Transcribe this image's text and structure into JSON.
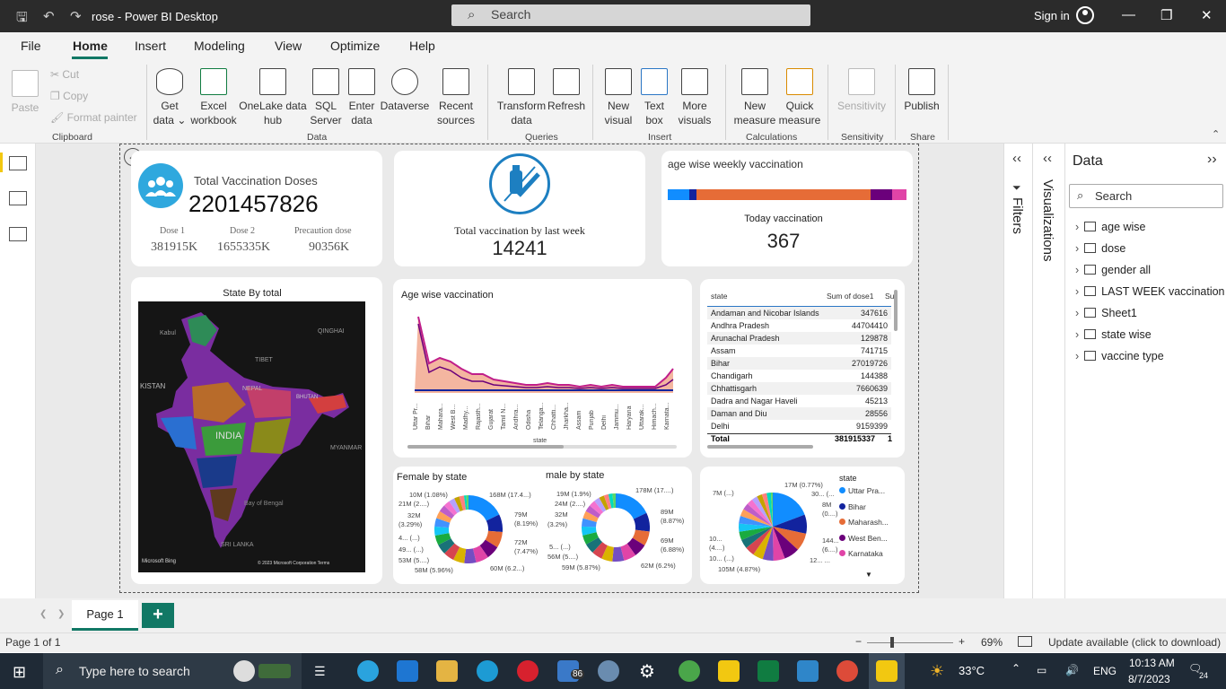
{
  "window": {
    "title": "rose - Power BI Desktop",
    "search_placeholder": "Search",
    "sign_in": "Sign in"
  },
  "menu": [
    "File",
    "Home",
    "Insert",
    "Modeling",
    "View",
    "Optimize",
    "Help"
  ],
  "ribbon": {
    "clipboard": {
      "paste": "Paste",
      "cut": "Cut",
      "copy": "Copy",
      "format_painter": "Format painter",
      "group": "Clipboard"
    },
    "data": {
      "get_data": "Get data",
      "excel": "Excel workbook",
      "onelake": "OneLake data hub",
      "sql": "SQL Server",
      "enter": "Enter data",
      "dataverse": "Dataverse",
      "recent": "Recent sources",
      "group": "Data"
    },
    "queries": {
      "transform": "Transform data",
      "refresh": "Refresh",
      "group": "Queries"
    },
    "insert": {
      "new_visual": "New visual",
      "text_box": "Text box",
      "more": "More visuals",
      "group": "Insert"
    },
    "calculations": {
      "new_measure": "New measure",
      "quick_measure": "Quick measure",
      "group": "Calculations"
    },
    "sensitivity": {
      "label": "Sensitivity",
      "group": "Sensitivity"
    },
    "share": {
      "publish": "Publish",
      "group": "Share"
    }
  },
  "cards": {
    "total": {
      "title": "Total Vaccination Doses",
      "value": "2201457826",
      "dose1_label": "Dose 1",
      "dose1": "381915K",
      "dose2_label": "Dose 2",
      "dose2": "1655335K",
      "prec_label": "Precaution dose",
      "prec": "90356K"
    },
    "lastweek": {
      "label": "Total vaccination by last week",
      "value": "14241"
    },
    "agewise": {
      "title": "age wise weekly vaccination",
      "today_label": "Today vaccination",
      "today": "367"
    }
  },
  "map": {
    "title": "State By total",
    "labels": [
      "INDIA",
      "NEPAL",
      "TIBET",
      "QINGHAI",
      "KISTAN",
      "MYANMAR",
      "SRI LANKA",
      "Kabul",
      "Bay of Bengal",
      "BHUTAN"
    ],
    "attribution": "© 2023 Microsoft Corporation  Terms",
    "logo": "Microsoft Bing"
  },
  "area": {
    "title": "Age wise vaccination",
    "xlabel": "state",
    "states": [
      "Uttar Pr...",
      "Bihar",
      "Mahara...",
      "West B...",
      "Madhy...",
      "Rajasth...",
      "Gujarat",
      "Tamil N...",
      "Andhra...",
      "Odisha",
      "Telanga...",
      "Chhatti...",
      "Jharkha...",
      "Assam",
      "Punjab",
      "Delhi",
      "Jammu...",
      "Haryana",
      "Uttarak...",
      "Himach...",
      "Karnata..."
    ]
  },
  "table": {
    "col1": "state",
    "col2": "Sum of dose1",
    "col3": "Su",
    "rows": [
      [
        "Andaman and Nicobar Islands",
        "347616"
      ],
      [
        "Andhra Pradesh",
        "44704410"
      ],
      [
        "Arunachal Pradesh",
        "129878"
      ],
      [
        "Assam",
        "741715"
      ],
      [
        "Bihar",
        "27019726"
      ],
      [
        "Chandigarh",
        "144388"
      ],
      [
        "Chhattisgarh",
        "7660639"
      ],
      [
        "Dadra and Nagar Haveli",
        "45213"
      ],
      [
        "Daman and Diu",
        "28556"
      ],
      [
        "Delhi",
        "9159399"
      ]
    ],
    "total_label": "Total",
    "total": "381915337",
    "total2": "1"
  },
  "donuts": {
    "female_title": "Female by state",
    "male_title": "male by state",
    "female_labels": [
      "10M (1.08%)",
      "168M (17.4...)",
      "21M (2....)",
      "32M",
      "(3.29%)",
      "79M",
      "(8.19%)",
      "4... (...)",
      "72M",
      "49... (...)",
      "(7.47%)",
      "53M (5....)",
      "58M (5.96%)",
      "60M (6.2...)"
    ],
    "male_labels": [
      "19M (1.9%)",
      "178M (17....)",
      "24M (2....)",
      "89M",
      "32M",
      "(8.87%)",
      "(3.2%)",
      "5... (...)",
      "69M",
      "56M (5....)",
      "(6.88%)",
      "59M (5.87%)",
      "62M (6.2%)"
    ]
  },
  "pie": {
    "legend_title": "state",
    "labels": [
      "17M (0.77%)",
      "7M (...)",
      "30... (...",
      "8M",
      "(0....)",
      "10...",
      "(4....)",
      "144...",
      "(6....)",
      "10... (...)",
      "12... ...",
      "105M (4.87%)"
    ],
    "legend": [
      {
        "name": "Uttar Pra...",
        "color": "#118dff"
      },
      {
        "name": "Bihar",
        "color": "#12239e"
      },
      {
        "name": "Maharash...",
        "color": "#e66c37"
      },
      {
        "name": "West Ben...",
        "color": "#6b007b"
      },
      {
        "name": "Karnataka",
        "color": "#e044a7"
      }
    ]
  },
  "panes": {
    "filters": "Filters",
    "visualizations": "Visualizations",
    "data_title": "Data",
    "data_search": "Search",
    "fields": [
      "age wise",
      "dose",
      "gender all",
      "LAST WEEK vaccination",
      "Sheet1",
      "state wise",
      "vaccine type"
    ]
  },
  "pages": {
    "tab": "Page 1",
    "add": "+"
  },
  "status": {
    "page": "Page 1 of 1",
    "zoom": "69%",
    "update": "Update available (click to download)"
  },
  "taskbar": {
    "search": "Type here to search",
    "weather": "33°C",
    "lang": "ENG",
    "time": "10:13 AM",
    "date": "8/7/2023",
    "mail_badge": "86",
    "notif": "24"
  }
}
